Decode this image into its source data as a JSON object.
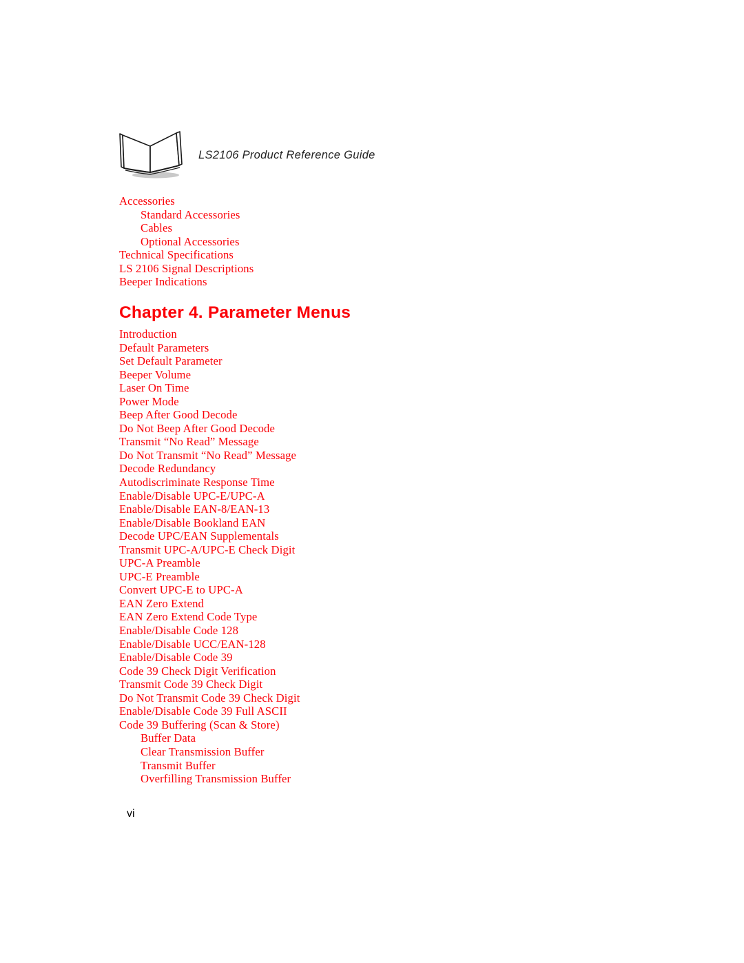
{
  "header": {
    "icon": "open-book-icon",
    "title": "LS2106 Product Reference Guide"
  },
  "toc_continued": [
    {
      "label": "Accessories",
      "level": 1
    },
    {
      "label": "Standard Accessories",
      "level": 2
    },
    {
      "label": "Cables",
      "level": 2
    },
    {
      "label": "Optional Accessories",
      "level": 2
    },
    {
      "label": "Technical Specifications",
      "level": 1
    },
    {
      "label": "LS 2106 Signal Descriptions",
      "level": 1
    },
    {
      "label": "Beeper Indications",
      "level": 1
    }
  ],
  "chapter": {
    "heading": "Chapter 4. Parameter Menus"
  },
  "toc_chapter4": [
    {
      "label": "Introduction",
      "level": 1
    },
    {
      "label": "Default Parameters",
      "level": 1
    },
    {
      "label": "Set Default Parameter",
      "level": 1
    },
    {
      "label": "Beeper Volume",
      "level": 1
    },
    {
      "label": "Laser On Time",
      "level": 1
    },
    {
      "label": "Power Mode",
      "level": 1
    },
    {
      "label": "Beep After Good Decode",
      "level": 1
    },
    {
      "label": "Do Not Beep After Good Decode",
      "level": 1
    },
    {
      "label": "Transmit “No Read” Message",
      "level": 1
    },
    {
      "label": "Do Not Transmit “No Read” Message",
      "level": 1
    },
    {
      "label": "Decode Redundancy",
      "level": 1
    },
    {
      "label": "Autodiscriminate Response Time",
      "level": 1
    },
    {
      "label": "Enable/Disable UPC-E/UPC-A",
      "level": 1
    },
    {
      "label": "Enable/Disable EAN-8/EAN-13",
      "level": 1
    },
    {
      "label": "Enable/Disable Bookland EAN",
      "level": 1
    },
    {
      "label": "Decode UPC/EAN Supplementals",
      "level": 1
    },
    {
      "label": "Transmit UPC-A/UPC-E Check Digit",
      "level": 1
    },
    {
      "label": "UPC-A Preamble",
      "level": 1
    },
    {
      "label": "UPC-E Preamble",
      "level": 1
    },
    {
      "label": "Convert UPC-E to UPC-A",
      "level": 1
    },
    {
      "label": "EAN Zero Extend",
      "level": 1
    },
    {
      "label": "EAN Zero Extend Code Type",
      "level": 1
    },
    {
      "label": "Enable/Disable Code 128",
      "level": 1
    },
    {
      "label": "Enable/Disable UCC/EAN-128",
      "level": 1
    },
    {
      "label": "Enable/Disable Code 39",
      "level": 1
    },
    {
      "label": "Code 39 Check Digit Verification",
      "level": 1
    },
    {
      "label": "Transmit Code 39 Check Digit",
      "level": 1
    },
    {
      "label": "Do Not Transmit Code 39 Check Digit",
      "level": 1
    },
    {
      "label": "Enable/Disable Code 39 Full ASCII",
      "level": 1
    },
    {
      "label": "Code 39 Buffering (Scan & Store)",
      "level": 1
    },
    {
      "label": "Buffer Data",
      "level": 2
    },
    {
      "label": "Clear Transmission Buffer",
      "level": 2
    },
    {
      "label": "Transmit Buffer",
      "level": 2
    },
    {
      "label": "Overfilling Transmission Buffer",
      "level": 2
    }
  ],
  "footer": {
    "page_number": "vi"
  },
  "colors": {
    "toc_red": "#fb0007",
    "header_text": "#222222",
    "page_background": "#ffffff"
  }
}
